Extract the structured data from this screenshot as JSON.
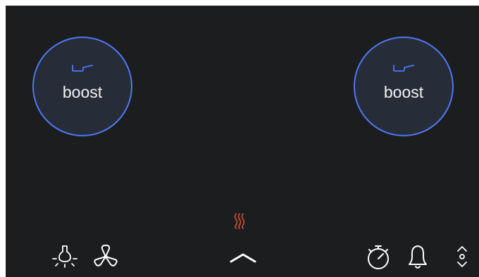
{
  "zones": {
    "left": {
      "label": "boost",
      "icon": "pan-icon"
    },
    "right": {
      "label": "boost",
      "icon": "pan-icon"
    }
  },
  "colors": {
    "background": "#1b1d1f",
    "zone_fill": "#272c39",
    "zone_ring": "#4f78f4",
    "pan_icon": "#4f78f4",
    "heat_indicator": "#e0522b",
    "icon": "#ffffff"
  },
  "bottom_bar": {
    "icons": [
      "light-icon",
      "fan-icon",
      "heat-indicator-icon",
      "chevron-up-icon",
      "timer-icon",
      "bell-icon",
      "up-down-arrows-icon"
    ]
  }
}
